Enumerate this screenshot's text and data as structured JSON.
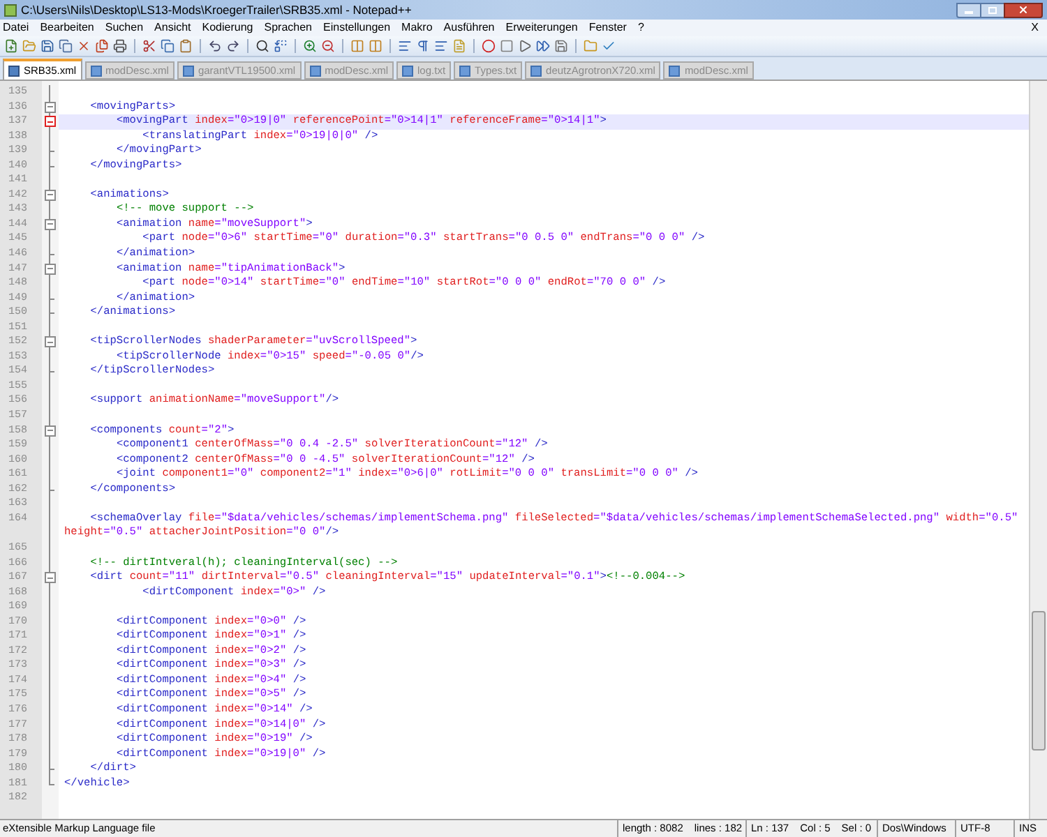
{
  "window": {
    "title": "C:\\Users\\Nils\\Desktop\\LS13-Mods\\KroegerTrailer\\SRB35.xml - Notepad++"
  },
  "menu": [
    "Datei",
    "Bearbeiten",
    "Suchen",
    "Ansicht",
    "Kodierung",
    "Sprachen",
    "Einstellungen",
    "Makro",
    "Ausführen",
    "Erweiterungen",
    "Fenster",
    "?"
  ],
  "menu_close": "X",
  "tabs": [
    {
      "label": "SRB35.xml",
      "selected": true
    },
    {
      "label": "modDesc.xml",
      "selected": false
    },
    {
      "label": "garantVTL19500.xml",
      "selected": false
    },
    {
      "label": "modDesc.xml",
      "selected": false
    },
    {
      "label": "log.txt",
      "selected": false
    },
    {
      "label": "Types.txt",
      "selected": false
    },
    {
      "label": "deutzAgrotronX720.xml",
      "selected": false
    },
    {
      "label": "modDesc.xml",
      "selected": false
    }
  ],
  "lines": [
    {
      "n": "135",
      "kind": "plain",
      "current": false
    },
    {
      "n": "136",
      "code": "    <movingParts>",
      "kind": "open",
      "current": false
    },
    {
      "n": "137",
      "code": "        <movingPart index=\"0>19|0\" referencePoint=\"0>14|1\" referenceFrame=\"0>14|1\">",
      "kind": "open",
      "current": true
    },
    {
      "n": "138",
      "code": "            <translatingPart index=\"0>19|0|0\" />",
      "kind": "plain",
      "current": false
    },
    {
      "n": "139",
      "code": "        </movingPart>",
      "kind": "close",
      "current": false
    },
    {
      "n": "140",
      "code": "    </movingParts>",
      "kind": "close",
      "current": false
    },
    {
      "n": "141",
      "kind": "plain",
      "current": false
    },
    {
      "n": "142",
      "code": "    <animations>",
      "kind": "open",
      "current": false
    },
    {
      "n": "143",
      "code": "        <!-- move support -->",
      "kind": "plain",
      "current": false
    },
    {
      "n": "144",
      "code": "        <animation name=\"moveSupport\">",
      "kind": "open",
      "current": false
    },
    {
      "n": "145",
      "code": "            <part node=\"0>6\" startTime=\"0\" duration=\"0.3\" startTrans=\"0 0.5 0\" endTrans=\"0 0 0\" />",
      "kind": "plain",
      "current": false
    },
    {
      "n": "146",
      "code": "        </animation>",
      "kind": "close",
      "current": false
    },
    {
      "n": "147",
      "code": "        <animation name=\"tipAnimationBack\">",
      "kind": "open",
      "current": false
    },
    {
      "n": "148",
      "code": "            <part node=\"0>14\" startTime=\"0\" endTime=\"10\" startRot=\"0 0 0\" endRot=\"70 0 0\" />",
      "kind": "plain",
      "current": false
    },
    {
      "n": "149",
      "code": "        </animation>",
      "kind": "close",
      "current": false
    },
    {
      "n": "150",
      "code": "    </animations>",
      "kind": "close",
      "current": false
    },
    {
      "n": "151",
      "kind": "plain",
      "current": false
    },
    {
      "n": "152",
      "code": "    <tipScrollerNodes shaderParameter=\"uvScrollSpeed\">",
      "kind": "open",
      "current": false
    },
    {
      "n": "153",
      "code": "        <tipScrollerNode index=\"0>15\" speed=\"-0.05 0\"/>",
      "kind": "plain",
      "current": false
    },
    {
      "n": "154",
      "code": "    </tipScrollerNodes>",
      "kind": "close",
      "current": false
    },
    {
      "n": "155",
      "kind": "plain",
      "current": false
    },
    {
      "n": "156",
      "code": "    <support animationName=\"moveSupport\"/>",
      "kind": "plain",
      "current": false
    },
    {
      "n": "157",
      "kind": "plain",
      "current": false
    },
    {
      "n": "158",
      "code": "    <components count=\"2\">",
      "kind": "open",
      "current": false
    },
    {
      "n": "159",
      "code": "        <component1 centerOfMass=\"0 0.4 -2.5\" solverIterationCount=\"12\" />",
      "kind": "plain",
      "current": false
    },
    {
      "n": "160",
      "code": "        <component2 centerOfMass=\"0 0 -4.5\" solverIterationCount=\"12\" />",
      "kind": "plain",
      "current": false
    },
    {
      "n": "161",
      "code": "        <joint component1=\"0\" component2=\"1\" index=\"0>6|0\" rotLimit=\"0 0 0\" transLimit=\"0 0 0\" />",
      "kind": "plain",
      "current": false
    },
    {
      "n": "162",
      "code": "    </components>",
      "kind": "close",
      "current": false
    },
    {
      "n": "163",
      "kind": "plain",
      "current": false
    },
    {
      "n": "164",
      "code": "    <schemaOverlay file=\"$data/vehicles/schemas/implementSchema.png\" fileSelected=\"$data/vehicles/schemas/implementSchemaSelected.png\" width=\"0.5\" height=\"0.5\" attacherJointPosition=\"0 0\"/>",
      "kind": "plain",
      "current": false
    },
    {
      "n": "165",
      "kind": "plain",
      "current": false
    },
    {
      "n": "166",
      "code": "    <!-- dirtIntveral(h); cleaningInterval(sec) -->",
      "kind": "plain",
      "current": false
    },
    {
      "n": "167",
      "code": "    <dirt count=\"11\" dirtInterval=\"0.5\" cleaningInterval=\"15\" updateInterval=\"0.1\"><!--0.004-->",
      "kind": "open",
      "current": false
    },
    {
      "n": "168",
      "code": "            <dirtComponent index=\"0>\" />",
      "kind": "plain",
      "current": false
    },
    {
      "n": "169",
      "kind": "plain",
      "current": false
    },
    {
      "n": "170",
      "code": "        <dirtComponent index=\"0>0\" />",
      "kind": "plain",
      "current": false
    },
    {
      "n": "171",
      "code": "        <dirtComponent index=\"0>1\" />",
      "kind": "plain",
      "current": false
    },
    {
      "n": "172",
      "code": "        <dirtComponent index=\"0>2\" />",
      "kind": "plain",
      "current": false
    },
    {
      "n": "173",
      "code": "        <dirtComponent index=\"0>3\" />",
      "kind": "plain",
      "current": false
    },
    {
      "n": "174",
      "code": "        <dirtComponent index=\"0>4\" />",
      "kind": "plain",
      "current": false
    },
    {
      "n": "175",
      "code": "        <dirtComponent index=\"0>5\" />",
      "kind": "plain",
      "current": false
    },
    {
      "n": "176",
      "code": "        <dirtComponent index=\"0>14\" />",
      "kind": "plain",
      "current": false
    },
    {
      "n": "177",
      "code": "        <dirtComponent index=\"0>14|0\" />",
      "kind": "plain",
      "current": false
    },
    {
      "n": "178",
      "code": "        <dirtComponent index=\"0>19\" />",
      "kind": "plain",
      "current": false
    },
    {
      "n": "179",
      "code": "        <dirtComponent index=\"0>19|0\" />",
      "kind": "plain",
      "current": false
    },
    {
      "n": "180",
      "code": "    </dirt>",
      "kind": "close",
      "current": false
    },
    {
      "n": "181",
      "code": "</vehicle>",
      "kind": "close",
      "current": false
    },
    {
      "n": "182",
      "kind": "plain",
      "current": false
    }
  ],
  "status_bar": {
    "file_type": "eXtensible Markup Language file",
    "length": "length : 8082",
    "lines": "lines : 182",
    "ln": "Ln : 137",
    "col": "Col : 5",
    "sel": "Sel : 0",
    "eol": "Dos\\Windows",
    "encoding": "UTF-8",
    "mode": "INS"
  }
}
